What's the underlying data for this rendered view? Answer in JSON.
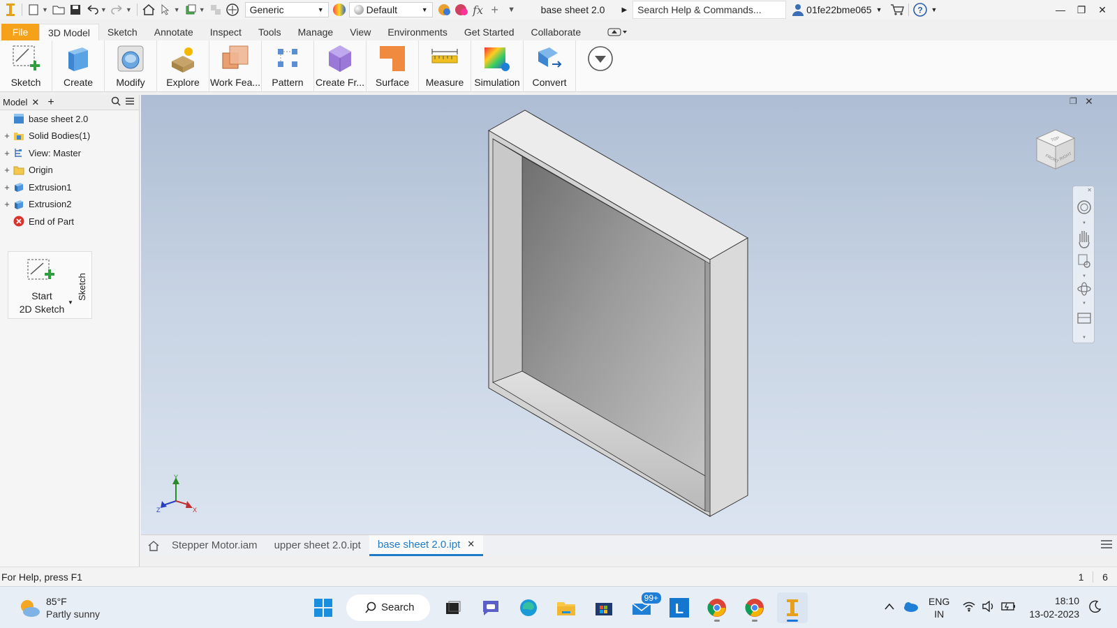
{
  "qat": {
    "material": "Generic",
    "appearance": "Default",
    "doc_title": "base sheet 2.0",
    "help_search": "Search Help & Commands...",
    "user": "01fe22bme065",
    "fx_label": "fx"
  },
  "ribbon_tabs": [
    "File",
    "3D Model",
    "Sketch",
    "Annotate",
    "Inspect",
    "Tools",
    "Manage",
    "View",
    "Environments",
    "Get Started",
    "Collaborate"
  ],
  "ribbon_active_tab": "3D Model",
  "ribbon_buttons": [
    {
      "label": "Sketch",
      "icon": "sketch-icon"
    },
    {
      "label": "Create",
      "icon": "create-icon"
    },
    {
      "label": "Modify",
      "icon": "modify-icon"
    },
    {
      "label": "Explore",
      "icon": "explore-icon"
    },
    {
      "label": "Work Fea...",
      "icon": "work-features-icon"
    },
    {
      "label": "Pattern",
      "icon": "pattern-icon"
    },
    {
      "label": "Create Fr...",
      "icon": "create-freeform-icon"
    },
    {
      "label": "Surface",
      "icon": "surface-icon"
    },
    {
      "label": "Measure",
      "icon": "measure-icon"
    },
    {
      "label": "Simulation",
      "icon": "simulation-icon"
    },
    {
      "label": "Convert",
      "icon": "convert-icon"
    }
  ],
  "browser": {
    "tab": "Model",
    "tree": [
      {
        "label": "base sheet 2.0",
        "icon": "part-icon",
        "expandable": false
      },
      {
        "label": "Solid Bodies(1)",
        "icon": "solid-bodies-folder-icon",
        "expandable": true
      },
      {
        "label": "View: Master",
        "icon": "view-icon",
        "expandable": true
      },
      {
        "label": "Origin",
        "icon": "folder-icon",
        "expandable": true
      },
      {
        "label": "Extrusion1",
        "icon": "extrusion-icon",
        "expandable": true
      },
      {
        "label": "Extrusion2",
        "icon": "extrusion-icon",
        "expandable": true
      },
      {
        "label": "End of Part",
        "icon": "end-of-part-icon",
        "expandable": false
      }
    ],
    "sketch_card": {
      "line1": "Start",
      "line2": "2D Sketch",
      "side_label": "Sketch"
    }
  },
  "viewcube": {
    "top": "TOP",
    "front": "FRONT",
    "right": "RIGHT"
  },
  "axes": {
    "x": "X",
    "y": "Y",
    "z": "Z"
  },
  "doc_tabs": [
    {
      "label": "Stepper Motor.iam",
      "active": false
    },
    {
      "label": "upper sheet 2.0.ipt",
      "active": false
    },
    {
      "label": "base sheet 2.0.ipt",
      "active": true
    }
  ],
  "status": {
    "help": "For Help, press F1",
    "count1": "1",
    "count2": "6"
  },
  "taskbar": {
    "weather_temp": "85°F",
    "weather_desc": "Partly sunny",
    "search": "Search",
    "mail_badge": "99+",
    "lang1": "ENG",
    "lang2": "IN",
    "time": "18:10",
    "date": "13-02-2023"
  }
}
